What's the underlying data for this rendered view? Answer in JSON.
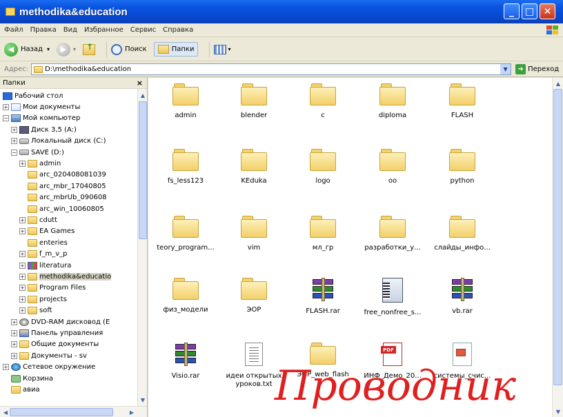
{
  "window": {
    "title": "methodika&education"
  },
  "menu": [
    "Файл",
    "Правка",
    "Вид",
    "Избранное",
    "Сервис",
    "Справка"
  ],
  "toolbar": {
    "back_label": "Назад",
    "search_label": "Поиск",
    "folders_label": "Папки"
  },
  "address": {
    "label": "Адрес:",
    "value": "D:\\methodika&education",
    "go_label": "Переход"
  },
  "folders_pane": {
    "title": "Папки",
    "tree": [
      {
        "label": "Рабочий стол",
        "icon": "desktop-icon",
        "expander": ""
      },
      {
        "label": "Мои документы",
        "icon": "docs-icon",
        "expander": "+"
      },
      {
        "label": "Мой компьютер",
        "icon": "computer-icon",
        "expander": "−"
      },
      {
        "label": "Диск 3,5 (A:)",
        "icon": "floppy-icon",
        "expander": "+"
      },
      {
        "label": "Локальный диск (C:)",
        "icon": "drive-icon",
        "expander": "+"
      },
      {
        "label": "SAVE (D:)",
        "icon": "drive-icon",
        "expander": "−"
      },
      {
        "label": "admin",
        "icon": "folder-icon",
        "expander": "+"
      },
      {
        "label": "arc_020408081039",
        "icon": "folder-icon",
        "expander": ""
      },
      {
        "label": "arc_mbr_17040805",
        "icon": "folder-icon",
        "expander": ""
      },
      {
        "label": "arc_mbrUb_090608",
        "icon": "folder-icon",
        "expander": ""
      },
      {
        "label": "arc_win_10060805",
        "icon": "folder-icon",
        "expander": ""
      },
      {
        "label": "cdutt",
        "icon": "folder-icon",
        "expander": "+"
      },
      {
        "label": "EA Games",
        "icon": "folder-icon",
        "expander": "+"
      },
      {
        "label": "enteries",
        "icon": "folder-icon",
        "expander": ""
      },
      {
        "label": "f_m_v_p",
        "icon": "folder-icon",
        "expander": "+"
      },
      {
        "label": "literatura",
        "icon": "books-icon",
        "expander": "+"
      },
      {
        "label": "methodika&educatio",
        "icon": "folder-icon",
        "expander": "+"
      },
      {
        "label": "Program Files",
        "icon": "folder-icon",
        "expander": "+"
      },
      {
        "label": "projects",
        "icon": "folder-icon",
        "expander": "+"
      },
      {
        "label": "soft",
        "icon": "folder-icon",
        "expander": "+"
      },
      {
        "label": "DVD-RAM дисковод (E",
        "icon": "dvd-icon",
        "expander": "+"
      },
      {
        "label": "Панель управления",
        "icon": "control-panel-icon",
        "expander": "+"
      },
      {
        "label": "Общие документы",
        "icon": "folder-icon",
        "expander": "+"
      },
      {
        "label": "Документы - sv",
        "icon": "folder-icon",
        "expander": "+"
      },
      {
        "label": "Сетевое окружение",
        "icon": "network-icon",
        "expander": "+"
      },
      {
        "label": "Корзина",
        "icon": "recycle-bin-icon",
        "expander": ""
      },
      {
        "label": "авиа",
        "icon": "folder-icon",
        "expander": ""
      }
    ]
  },
  "files": [
    {
      "name": "admin",
      "type": "folder"
    },
    {
      "name": "blender",
      "type": "folder"
    },
    {
      "name": "c",
      "type": "folder"
    },
    {
      "name": "diploma",
      "type": "folder"
    },
    {
      "name": "FLASH",
      "type": "folder"
    },
    {
      "name": "fs_less123",
      "type": "folder"
    },
    {
      "name": "KEduka",
      "type": "folder"
    },
    {
      "name": "logo",
      "type": "folder"
    },
    {
      "name": "oo",
      "type": "folder"
    },
    {
      "name": "python",
      "type": "folder"
    },
    {
      "name": "teory_program...",
      "type": "folder"
    },
    {
      "name": "vim",
      "type": "folder"
    },
    {
      "name": "мл_гр",
      "type": "folder"
    },
    {
      "name": "разработки_у...",
      "type": "folder"
    },
    {
      "name": "слайды_инфо...",
      "type": "folder"
    },
    {
      "name": "физ_модели",
      "type": "folder"
    },
    {
      "name": "ЭОР",
      "type": "folder"
    },
    {
      "name": "FLASH.rar",
      "type": "rar"
    },
    {
      "name": "free_nonfree_s...",
      "type": "msi"
    },
    {
      "name": "vb.rar",
      "type": "rar"
    },
    {
      "name": "Visio.rar",
      "type": "rar"
    },
    {
      "name": "идеи открытых уроков.txt",
      "type": "txt"
    },
    {
      "name": "ЭОР_web_flash",
      "type": "folder"
    },
    {
      "name": "ИНФ_Демо_20...",
      "type": "pdf"
    },
    {
      "name": "системы_счис...",
      "type": "ppt"
    }
  ],
  "overlay_caption": "Проводник"
}
